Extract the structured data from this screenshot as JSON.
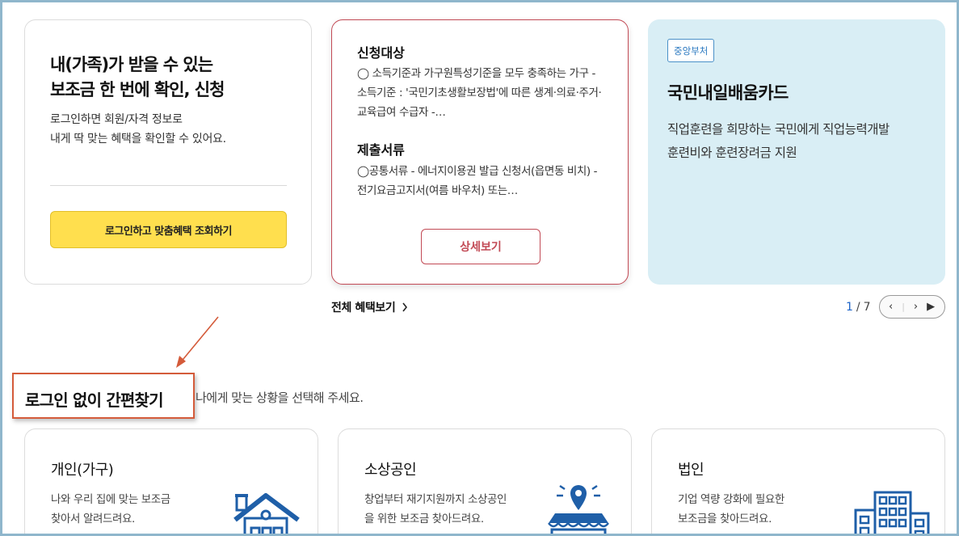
{
  "login_card": {
    "title": "내(가족)가 받을 수 있는\n보조금 한 번에 확인, 신청",
    "desc": "로그인하면 회원/자격 정보로\n내게 딱 맞는 혜택을 확인할 수 있어요.",
    "button": "로그인하고 맞춤혜택 조회하기"
  },
  "apply_card": {
    "target_title": "신청대상",
    "target_text": "◯ 소득기준과 가구원특성기준을 모두 충족하는 가구 - 소득기준 : '국민기초생활보장법'에 따른 생계·의료·주거·교육급여 수급자 -…",
    "docs_title": "제출서류",
    "docs_text": "◯공통서류 - 에너지이용권 발급 신청서(읍면동 비치) - 전기요금고지서(여름 바우처) 또는…",
    "button": "상세보기"
  },
  "edu_card": {
    "tag": "중앙부처",
    "title": "국민내일배움카드",
    "desc": "직업훈련을 희망하는 국민에게 직업능력개발\n훈련비와 훈련장려금 지원"
  },
  "all_benefits": {
    "label": "전체 혜택보기",
    "icon": "chevron-right-icon"
  },
  "pager": {
    "current": "1",
    "sep": "/",
    "total": "7",
    "prev": "‹",
    "next": "›",
    "play": "▶"
  },
  "quick_find": {
    "title": "로그인 없이 간편찾기",
    "guide": "나에게 맞는 상황을 선택해 주세요."
  },
  "categories": [
    {
      "title": "개인(가구)",
      "desc": "나와 우리 집에 맞는 보조금\n찾아서 알려드려요.",
      "icon": "house-icon"
    },
    {
      "title": "소상공인",
      "desc": "창업부터 재기지원까지 소상공인\n을 위한 보조금 찾아드려요.",
      "icon": "store-location-icon"
    },
    {
      "title": "법인",
      "desc": "기업 역량 강화에 필요한\n보조금을 찾아드려요.",
      "icon": "building-icon"
    }
  ],
  "colors": {
    "accent_red": "#c24a55",
    "yellow": "#ffdf4e",
    "edu_bg": "#d9eef5",
    "icon_blue": "#1f5fa8",
    "annotation": "#d45b3a"
  }
}
